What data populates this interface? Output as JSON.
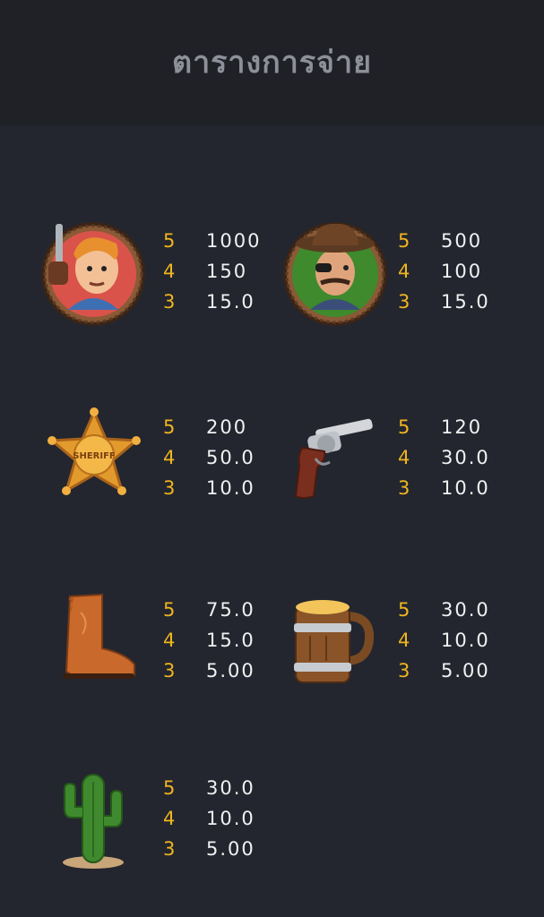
{
  "header": {
    "title": "ตารางการจ่าย"
  },
  "symbols": [
    {
      "icon": "sheriff-portrait-icon",
      "pays": [
        {
          "count": "5",
          "value": "1000"
        },
        {
          "count": "4",
          "value": "150"
        },
        {
          "count": "3",
          "value": "15.0"
        }
      ]
    },
    {
      "icon": "outlaw-portrait-icon",
      "pays": [
        {
          "count": "5",
          "value": "500"
        },
        {
          "count": "4",
          "value": "100"
        },
        {
          "count": "3",
          "value": "15.0"
        }
      ]
    },
    {
      "icon": "sheriff-badge-icon",
      "badge_text": "SHERIFF",
      "pays": [
        {
          "count": "5",
          "value": "200"
        },
        {
          "count": "4",
          "value": "50.0"
        },
        {
          "count": "3",
          "value": "10.0"
        }
      ]
    },
    {
      "icon": "revolver-icon",
      "pays": [
        {
          "count": "5",
          "value": "120"
        },
        {
          "count": "4",
          "value": "30.0"
        },
        {
          "count": "3",
          "value": "10.0"
        }
      ]
    },
    {
      "icon": "cowboy-boot-icon",
      "pays": [
        {
          "count": "5",
          "value": "75.0"
        },
        {
          "count": "4",
          "value": "15.0"
        },
        {
          "count": "3",
          "value": "5.00"
        }
      ]
    },
    {
      "icon": "beer-mug-icon",
      "pays": [
        {
          "count": "5",
          "value": "30.0"
        },
        {
          "count": "4",
          "value": "10.0"
        },
        {
          "count": "3",
          "value": "5.00"
        }
      ]
    },
    {
      "icon": "cactus-icon",
      "pays": [
        {
          "count": "5",
          "value": "30.0"
        },
        {
          "count": "4",
          "value": "10.0"
        },
        {
          "count": "3",
          "value": "5.00"
        }
      ]
    }
  ]
}
